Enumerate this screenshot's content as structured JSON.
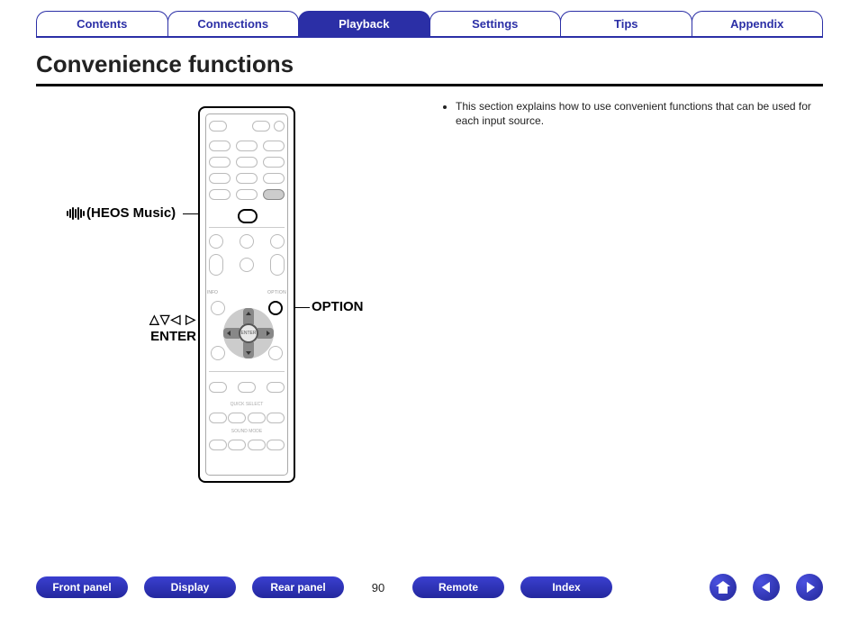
{
  "tabs": [
    "Contents",
    "Connections",
    "Playback",
    "Settings",
    "Tips",
    "Appendix"
  ],
  "active_tab_index": 2,
  "heading": "Convenience functions",
  "bullet": "This section explains how to use convenient functions that can be used for each input source.",
  "callouts": {
    "heos": "(HEOS Music)",
    "option": "OPTION",
    "enter": "ENTER"
  },
  "remote_labels": {
    "option": "OPTION",
    "info": "INFO",
    "enter": "ENTER",
    "quick_select": "QUICK SELECT",
    "sound_mode": "SOUND MODE"
  },
  "bottom_nav": [
    "Front panel",
    "Display",
    "Rear panel",
    "Remote",
    "Index"
  ],
  "page_number": "90"
}
